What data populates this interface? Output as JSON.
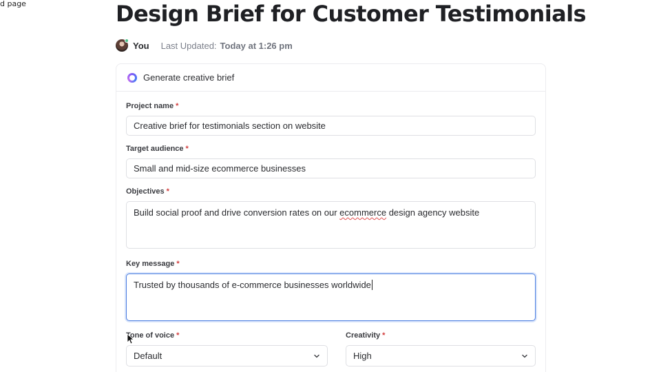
{
  "breadcrumb": {
    "text": "d page"
  },
  "page": {
    "title": "Design Brief for Customer Testimonials"
  },
  "meta": {
    "user": "You",
    "last_updated_label": "Last Updated:",
    "last_updated_value": "Today at 1:26 pm"
  },
  "card": {
    "header": "Generate creative brief",
    "project_name": {
      "label": "Project name",
      "required": "*",
      "value": "Creative brief for testimonials section on website"
    },
    "target_audience": {
      "label": "Target audience",
      "required": "*",
      "value": "Small and mid-size ecommerce businesses"
    },
    "objectives": {
      "label": "Objectives",
      "required": "*",
      "value_before": "Build social proof and drive conversion rates on our ",
      "value_misspelled": "ecommerce",
      "value_after": " design agency website"
    },
    "key_message": {
      "label": "Key message",
      "required": "*",
      "value": "Trusted by thousands of e-commerce businesses worldwide"
    },
    "tone_of_voice": {
      "label": "Tone of voice",
      "required": "*",
      "selected": "Default"
    },
    "creativity": {
      "label": "Creativity",
      "required": "*",
      "selected": "High"
    }
  },
  "icons": {
    "avatar": "user-avatar",
    "header_icon": "ai-sparkle-icon",
    "select_arrow": "chevron-down-icon",
    "cursor": "mouse-pointer-icon"
  },
  "colors": {
    "focus": "#4a7de0",
    "required": "#d23c3c",
    "presence": "#4cc38a"
  }
}
